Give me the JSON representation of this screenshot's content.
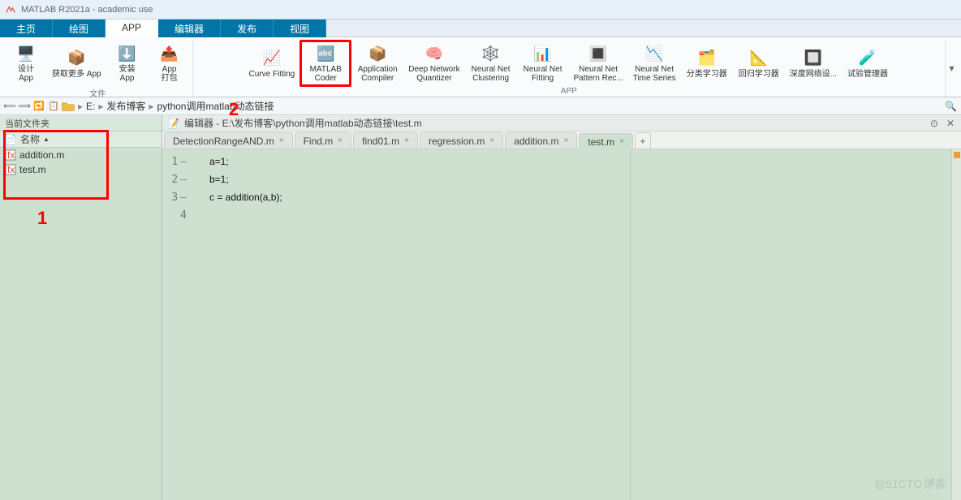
{
  "window": {
    "title": "MATLAB R2021a - academic use"
  },
  "main_tabs": {
    "items": [
      "主页",
      "绘图",
      "APP",
      "编辑器",
      "发布",
      "视图"
    ],
    "active_index": 2
  },
  "toolstrip": {
    "group1": {
      "design": "设计\nApp",
      "get_more": "获取更多 App",
      "install": "安装\nApp",
      "package": "App\n打包",
      "label": "文件"
    },
    "apps": [
      {
        "name": "Curve Fitting"
      },
      {
        "name": "MATLAB\nCoder",
        "highlight": true
      },
      {
        "name": "Application\nCompiler"
      },
      {
        "name": "Deep Network\nQuantizer"
      },
      {
        "name": "Neural Net\nClustering"
      },
      {
        "name": "Neural Net\nFitting"
      },
      {
        "name": "Neural Net\nPattern Rec..."
      },
      {
        "name": "Neural Net\nTime Series"
      },
      {
        "name": "分类学习器"
      },
      {
        "name": "回归学习器"
      },
      {
        "name": "深度网络设..."
      },
      {
        "name": "试验管理器"
      }
    ],
    "apps_label": "APP"
  },
  "path": {
    "drive": "E:",
    "crumbs": [
      "发布博客",
      "python调用matlab动态链接"
    ]
  },
  "sidebar": {
    "header": "当前文件夹",
    "col": "名称",
    "files": [
      {
        "name": "addition.m"
      },
      {
        "name": "test.m"
      }
    ]
  },
  "editor": {
    "title_prefix": "编辑器 - ",
    "title_path": "E:\\发布博客\\python调用matlab动态链接\\test.m",
    "tabs": [
      {
        "name": "DetectionRangeAND.m"
      },
      {
        "name": "Find.m"
      },
      {
        "name": "find01.m"
      },
      {
        "name": "regression.m"
      },
      {
        "name": "addition.m"
      },
      {
        "name": "test.m",
        "active": true
      }
    ],
    "lines": [
      "a=1;",
      "b=1;",
      "c = addition(a,b);",
      ""
    ]
  },
  "annotations": {
    "n1": "1",
    "n2": "2"
  },
  "watermark": "@51CTO博客"
}
